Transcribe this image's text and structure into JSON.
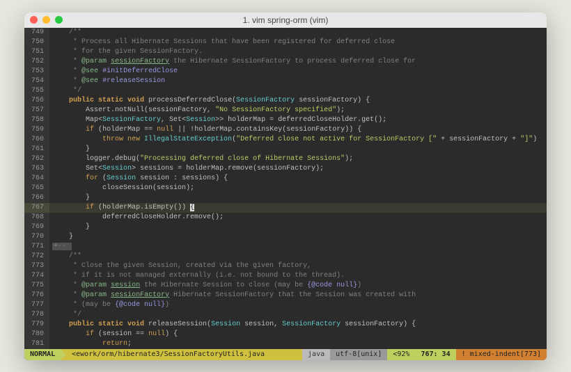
{
  "window": {
    "title": "1. vim spring-orm (vim)"
  },
  "gutter_start": 749,
  "lines": [
    {
      "n": 749,
      "tokens": [
        {
          "t": "    ",
          "c": ""
        },
        {
          "t": "/**",
          "c": "comment"
        }
      ]
    },
    {
      "n": 750,
      "tokens": [
        {
          "t": "     ",
          "c": ""
        },
        {
          "t": "* Process all Hibernate Sessions that have been registered for deferred close",
          "c": "comment"
        }
      ]
    },
    {
      "n": 751,
      "tokens": [
        {
          "t": "     ",
          "c": ""
        },
        {
          "t": "* for the given SessionFactory.",
          "c": "comment"
        }
      ]
    },
    {
      "n": 752,
      "tokens": [
        {
          "t": "     ",
          "c": ""
        },
        {
          "t": "* ",
          "c": "comment"
        },
        {
          "t": "@param",
          "c": "javadoc-tag"
        },
        {
          "t": " ",
          "c": "comment"
        },
        {
          "t": "sessionFactory",
          "c": "javadoc-param"
        },
        {
          "t": " the Hibernate SessionFactory to process deferred close for",
          "c": "comment"
        }
      ]
    },
    {
      "n": 753,
      "tokens": [
        {
          "t": "     ",
          "c": ""
        },
        {
          "t": "* ",
          "c": "comment"
        },
        {
          "t": "@see",
          "c": "javadoc-tag"
        },
        {
          "t": " ",
          "c": "comment"
        },
        {
          "t": "#initDeferredClose",
          "c": "javadoc-ref"
        }
      ]
    },
    {
      "n": 754,
      "tokens": [
        {
          "t": "     ",
          "c": ""
        },
        {
          "t": "* ",
          "c": "comment"
        },
        {
          "t": "@see",
          "c": "javadoc-tag"
        },
        {
          "t": " ",
          "c": "comment"
        },
        {
          "t": "#releaseSession",
          "c": "javadoc-ref"
        }
      ]
    },
    {
      "n": 755,
      "tokens": [
        {
          "t": "     ",
          "c": ""
        },
        {
          "t": "*/",
          "c": "comment"
        }
      ]
    },
    {
      "n": 756,
      "tokens": [
        {
          "t": "    ",
          "c": ""
        },
        {
          "t": "public static void",
          "c": "kw-bold"
        },
        {
          "t": " processDeferredClose",
          "c": "method"
        },
        {
          "t": "(",
          "c": "paren"
        },
        {
          "t": "SessionFactory",
          "c": "type"
        },
        {
          "t": " sessionFactory",
          "c": ""
        },
        {
          "t": ")",
          "c": "paren"
        },
        {
          "t": " {",
          "c": "brace"
        }
      ]
    },
    {
      "n": 757,
      "tokens": [
        {
          "t": "        Assert.notNull",
          "c": ""
        },
        {
          "t": "(",
          "c": "paren"
        },
        {
          "t": "sessionFactory, ",
          "c": ""
        },
        {
          "t": "\"No SessionFactory specified\"",
          "c": "str"
        },
        {
          "t": ")",
          "c": "paren"
        },
        {
          "t": ";",
          "c": ""
        }
      ]
    },
    {
      "n": 758,
      "tokens": [
        {
          "t": "        Map",
          "c": ""
        },
        {
          "t": "<",
          "c": "op"
        },
        {
          "t": "SessionFactory",
          "c": "type"
        },
        {
          "t": ", Set",
          "c": ""
        },
        {
          "t": "<",
          "c": "op"
        },
        {
          "t": "Session",
          "c": "type"
        },
        {
          "t": ">>",
          "c": "op"
        },
        {
          "t": " holderMap ",
          "c": ""
        },
        {
          "t": "=",
          "c": "op"
        },
        {
          "t": " deferredCloseHolder.get",
          "c": ""
        },
        {
          "t": "()",
          "c": "paren"
        },
        {
          "t": ";",
          "c": ""
        }
      ]
    },
    {
      "n": 759,
      "tokens": [
        {
          "t": "        ",
          "c": ""
        },
        {
          "t": "if",
          "c": "kw"
        },
        {
          "t": " ",
          "c": ""
        },
        {
          "t": "(",
          "c": "paren"
        },
        {
          "t": "holderMap ",
          "c": ""
        },
        {
          "t": "==",
          "c": "op"
        },
        {
          "t": " ",
          "c": ""
        },
        {
          "t": "null",
          "c": "kw"
        },
        {
          "t": " ",
          "c": ""
        },
        {
          "t": "||",
          "c": "op"
        },
        {
          "t": " ",
          "c": ""
        },
        {
          "t": "!",
          "c": "op"
        },
        {
          "t": "holderMap.containsKey",
          "c": ""
        },
        {
          "t": "(",
          "c": "paren"
        },
        {
          "t": "sessionFactory",
          "c": ""
        },
        {
          "t": "))",
          "c": "paren"
        },
        {
          "t": " {",
          "c": "brace"
        }
      ]
    },
    {
      "n": 760,
      "tokens": [
        {
          "t": "            ",
          "c": ""
        },
        {
          "t": "throw new",
          "c": "kw"
        },
        {
          "t": " IllegalStateException",
          "c": "type"
        },
        {
          "t": "(",
          "c": "paren"
        },
        {
          "t": "\"Deferred close not active for SessionFactory [\"",
          "c": "str"
        },
        {
          "t": " ",
          "c": ""
        },
        {
          "t": "+",
          "c": "op"
        },
        {
          "t": " sessionFactory ",
          "c": ""
        },
        {
          "t": "+",
          "c": "op"
        },
        {
          "t": " ",
          "c": ""
        },
        {
          "t": "\"]\"",
          "c": "str"
        },
        {
          "t": ")",
          "c": "paren"
        }
      ]
    },
    {
      "n": 761,
      "tokens": [
        {
          "t": "        ",
          "c": ""
        },
        {
          "t": "}",
          "c": "brace"
        }
      ]
    },
    {
      "n": 762,
      "tokens": [
        {
          "t": "        logger.debug",
          "c": ""
        },
        {
          "t": "(",
          "c": "paren"
        },
        {
          "t": "\"Processing deferred close of Hibernate Sessions\"",
          "c": "str"
        },
        {
          "t": ")",
          "c": "paren"
        },
        {
          "t": ";",
          "c": ""
        }
      ]
    },
    {
      "n": 763,
      "tokens": [
        {
          "t": "        Set",
          "c": ""
        },
        {
          "t": "<",
          "c": "op"
        },
        {
          "t": "Session",
          "c": "type"
        },
        {
          "t": ">",
          "c": "op"
        },
        {
          "t": " sessions ",
          "c": ""
        },
        {
          "t": "=",
          "c": "op"
        },
        {
          "t": " holderMap.remove",
          "c": ""
        },
        {
          "t": "(",
          "c": "paren"
        },
        {
          "t": "sessionFactory",
          "c": ""
        },
        {
          "t": ")",
          "c": "paren"
        },
        {
          "t": ";",
          "c": ""
        }
      ]
    },
    {
      "n": 764,
      "tokens": [
        {
          "t": "        ",
          "c": ""
        },
        {
          "t": "for",
          "c": "kw"
        },
        {
          "t": " ",
          "c": ""
        },
        {
          "t": "(",
          "c": "paren"
        },
        {
          "t": "Session",
          "c": "type"
        },
        {
          "t": " session ",
          "c": ""
        },
        {
          "t": ":",
          "c": "op"
        },
        {
          "t": " sessions",
          "c": ""
        },
        {
          "t": ")",
          "c": "paren"
        },
        {
          "t": " {",
          "c": "brace"
        }
      ]
    },
    {
      "n": 765,
      "tokens": [
        {
          "t": "            closeSession",
          "c": ""
        },
        {
          "t": "(",
          "c": "paren"
        },
        {
          "t": "session",
          "c": ""
        },
        {
          "t": ")",
          "c": "paren"
        },
        {
          "t": ";",
          "c": ""
        }
      ]
    },
    {
      "n": 766,
      "tokens": [
        {
          "t": "        ",
          "c": ""
        },
        {
          "t": "}",
          "c": "brace"
        }
      ]
    },
    {
      "n": 767,
      "hl": true,
      "tokens": [
        {
          "t": "        ",
          "c": ""
        },
        {
          "t": "if",
          "c": "kw"
        },
        {
          "t": " ",
          "c": ""
        },
        {
          "t": "(",
          "c": "paren"
        },
        {
          "t": "holderMap.isEmpty",
          "c": ""
        },
        {
          "t": "())",
          "c": "paren"
        },
        {
          "t": " ",
          "c": ""
        },
        {
          "t": "{",
          "c": "cursor"
        }
      ]
    },
    {
      "n": 768,
      "tokens": [
        {
          "t": "            deferredCloseHolder.remove",
          "c": ""
        },
        {
          "t": "()",
          "c": "paren"
        },
        {
          "t": ";",
          "c": ""
        }
      ]
    },
    {
      "n": 769,
      "tokens": [
        {
          "t": "        ",
          "c": ""
        },
        {
          "t": "}",
          "c": "brace"
        }
      ]
    },
    {
      "n": 770,
      "tokens": [
        {
          "t": "    ",
          "c": ""
        },
        {
          "t": "}",
          "c": "brace"
        }
      ]
    },
    {
      "n": 771,
      "fold": true,
      "tokens": [
        {
          "t": "",
          "c": ""
        }
      ]
    },
    {
      "n": 772,
      "tokens": [
        {
          "t": "    ",
          "c": ""
        },
        {
          "t": "/**",
          "c": "comment"
        }
      ]
    },
    {
      "n": 773,
      "tokens": [
        {
          "t": "     ",
          "c": ""
        },
        {
          "t": "* Close the given Session, created via the given factory,",
          "c": "comment"
        }
      ]
    },
    {
      "n": 774,
      "tokens": [
        {
          "t": "     ",
          "c": ""
        },
        {
          "t": "* if it is not managed externally (i.e. not bound to the thread).",
          "c": "comment"
        }
      ]
    },
    {
      "n": 775,
      "tokens": [
        {
          "t": "     ",
          "c": ""
        },
        {
          "t": "* ",
          "c": "comment"
        },
        {
          "t": "@param",
          "c": "javadoc-tag"
        },
        {
          "t": " ",
          "c": "comment"
        },
        {
          "t": "session",
          "c": "javadoc-param"
        },
        {
          "t": " the Hibernate Session to close (may be ",
          "c": "comment"
        },
        {
          "t": "{@code null}",
          "c": "javadoc-ref"
        },
        {
          "t": ")",
          "c": "comment"
        }
      ]
    },
    {
      "n": 776,
      "tokens": [
        {
          "t": "     ",
          "c": ""
        },
        {
          "t": "* ",
          "c": "comment"
        },
        {
          "t": "@param",
          "c": "javadoc-tag"
        },
        {
          "t": " ",
          "c": "comment"
        },
        {
          "t": "sessionFactory",
          "c": "javadoc-param"
        },
        {
          "t": " Hibernate SessionFactory that the Session was created with",
          "c": "comment"
        }
      ]
    },
    {
      "n": 777,
      "tokens": [
        {
          "t": "     ",
          "c": ""
        },
        {
          "t": "* (may be ",
          "c": "comment"
        },
        {
          "t": "{@code null}",
          "c": "javadoc-ref"
        },
        {
          "t": ")",
          "c": "comment"
        }
      ]
    },
    {
      "n": 778,
      "tokens": [
        {
          "t": "     ",
          "c": ""
        },
        {
          "t": "*/",
          "c": "comment"
        }
      ]
    },
    {
      "n": 779,
      "tokens": [
        {
          "t": "    ",
          "c": ""
        },
        {
          "t": "public static void",
          "c": "kw-bold"
        },
        {
          "t": " releaseSession",
          "c": "method"
        },
        {
          "t": "(",
          "c": "paren"
        },
        {
          "t": "Session",
          "c": "type"
        },
        {
          "t": " session, ",
          "c": ""
        },
        {
          "t": "SessionFactory",
          "c": "type"
        },
        {
          "t": " sessionFactory",
          "c": ""
        },
        {
          "t": ")",
          "c": "paren"
        },
        {
          "t": " {",
          "c": "brace"
        }
      ]
    },
    {
      "n": 780,
      "tokens": [
        {
          "t": "        ",
          "c": ""
        },
        {
          "t": "if",
          "c": "kw"
        },
        {
          "t": " ",
          "c": ""
        },
        {
          "t": "(",
          "c": "paren"
        },
        {
          "t": "session ",
          "c": ""
        },
        {
          "t": "==",
          "c": "op"
        },
        {
          "t": " ",
          "c": ""
        },
        {
          "t": "null",
          "c": "kw"
        },
        {
          "t": ")",
          "c": "paren"
        },
        {
          "t": " {",
          "c": "brace"
        }
      ]
    },
    {
      "n": 781,
      "tokens": [
        {
          "t": "            ",
          "c": ""
        },
        {
          "t": "return",
          "c": "kw"
        },
        {
          "t": ";",
          "c": ""
        }
      ]
    }
  ],
  "statusline": {
    "mode": "NORMAL",
    "file": "<ework/orm/hibernate3/SessionFactoryUtils.java",
    "filetype": "java",
    "encoding": "utf-8[unix]",
    "percent": "92%",
    "position": "767: 34",
    "warning": "! mixed-indent[773]"
  }
}
